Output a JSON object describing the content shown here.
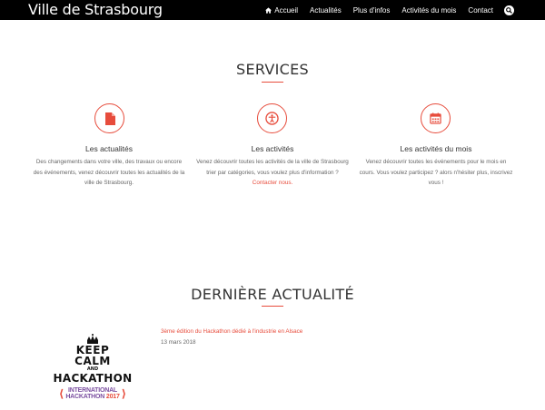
{
  "brand": "Ville de Strasbourg",
  "nav": {
    "home": "Accueil",
    "news": "Actualités",
    "more": "Plus d'infos",
    "month": "Activités du mois",
    "contact": "Contact"
  },
  "services": {
    "title": "SERVICES",
    "items": [
      {
        "icon": "document-icon",
        "title": "Les actualités",
        "lines": [
          "Des changements dans votre ville, des travaux ou encore",
          "des événements, venez découvrir toutes les actualités de la",
          "ville de Strasbourg."
        ]
      },
      {
        "icon": "accessibility-icon",
        "title": "Les activités",
        "lines": [
          "Venez découvrir toutes les activités de la ville de Strasbourg",
          "trier par catégories, vous voulez plus d'information ?"
        ],
        "link": "Contacter nous."
      },
      {
        "icon": "calendar-icon",
        "title": "Les activités du mois",
        "lines": [
          "Venez découvrir toutes les événements pour le mois en",
          "cours. Vous voulez participez ? alors n'hésiter plus, inscrivez",
          "vous !"
        ]
      }
    ]
  },
  "news": {
    "title": "DERNIÈRE ACTUALITÉ",
    "article_title": "3ème édition du Hackathon dédié à l'industrie en Alsace",
    "date": "13 mars 2018",
    "image": {
      "line1": "KEEP",
      "line2": "CALM",
      "line3": "AND",
      "line4": "HACKATHON",
      "badge1": "INTERNATIONAL",
      "badge2": "HACKATHON",
      "badge3": "2017"
    }
  },
  "colors": {
    "accent": "#e74c3c",
    "navbar": "#000000"
  }
}
